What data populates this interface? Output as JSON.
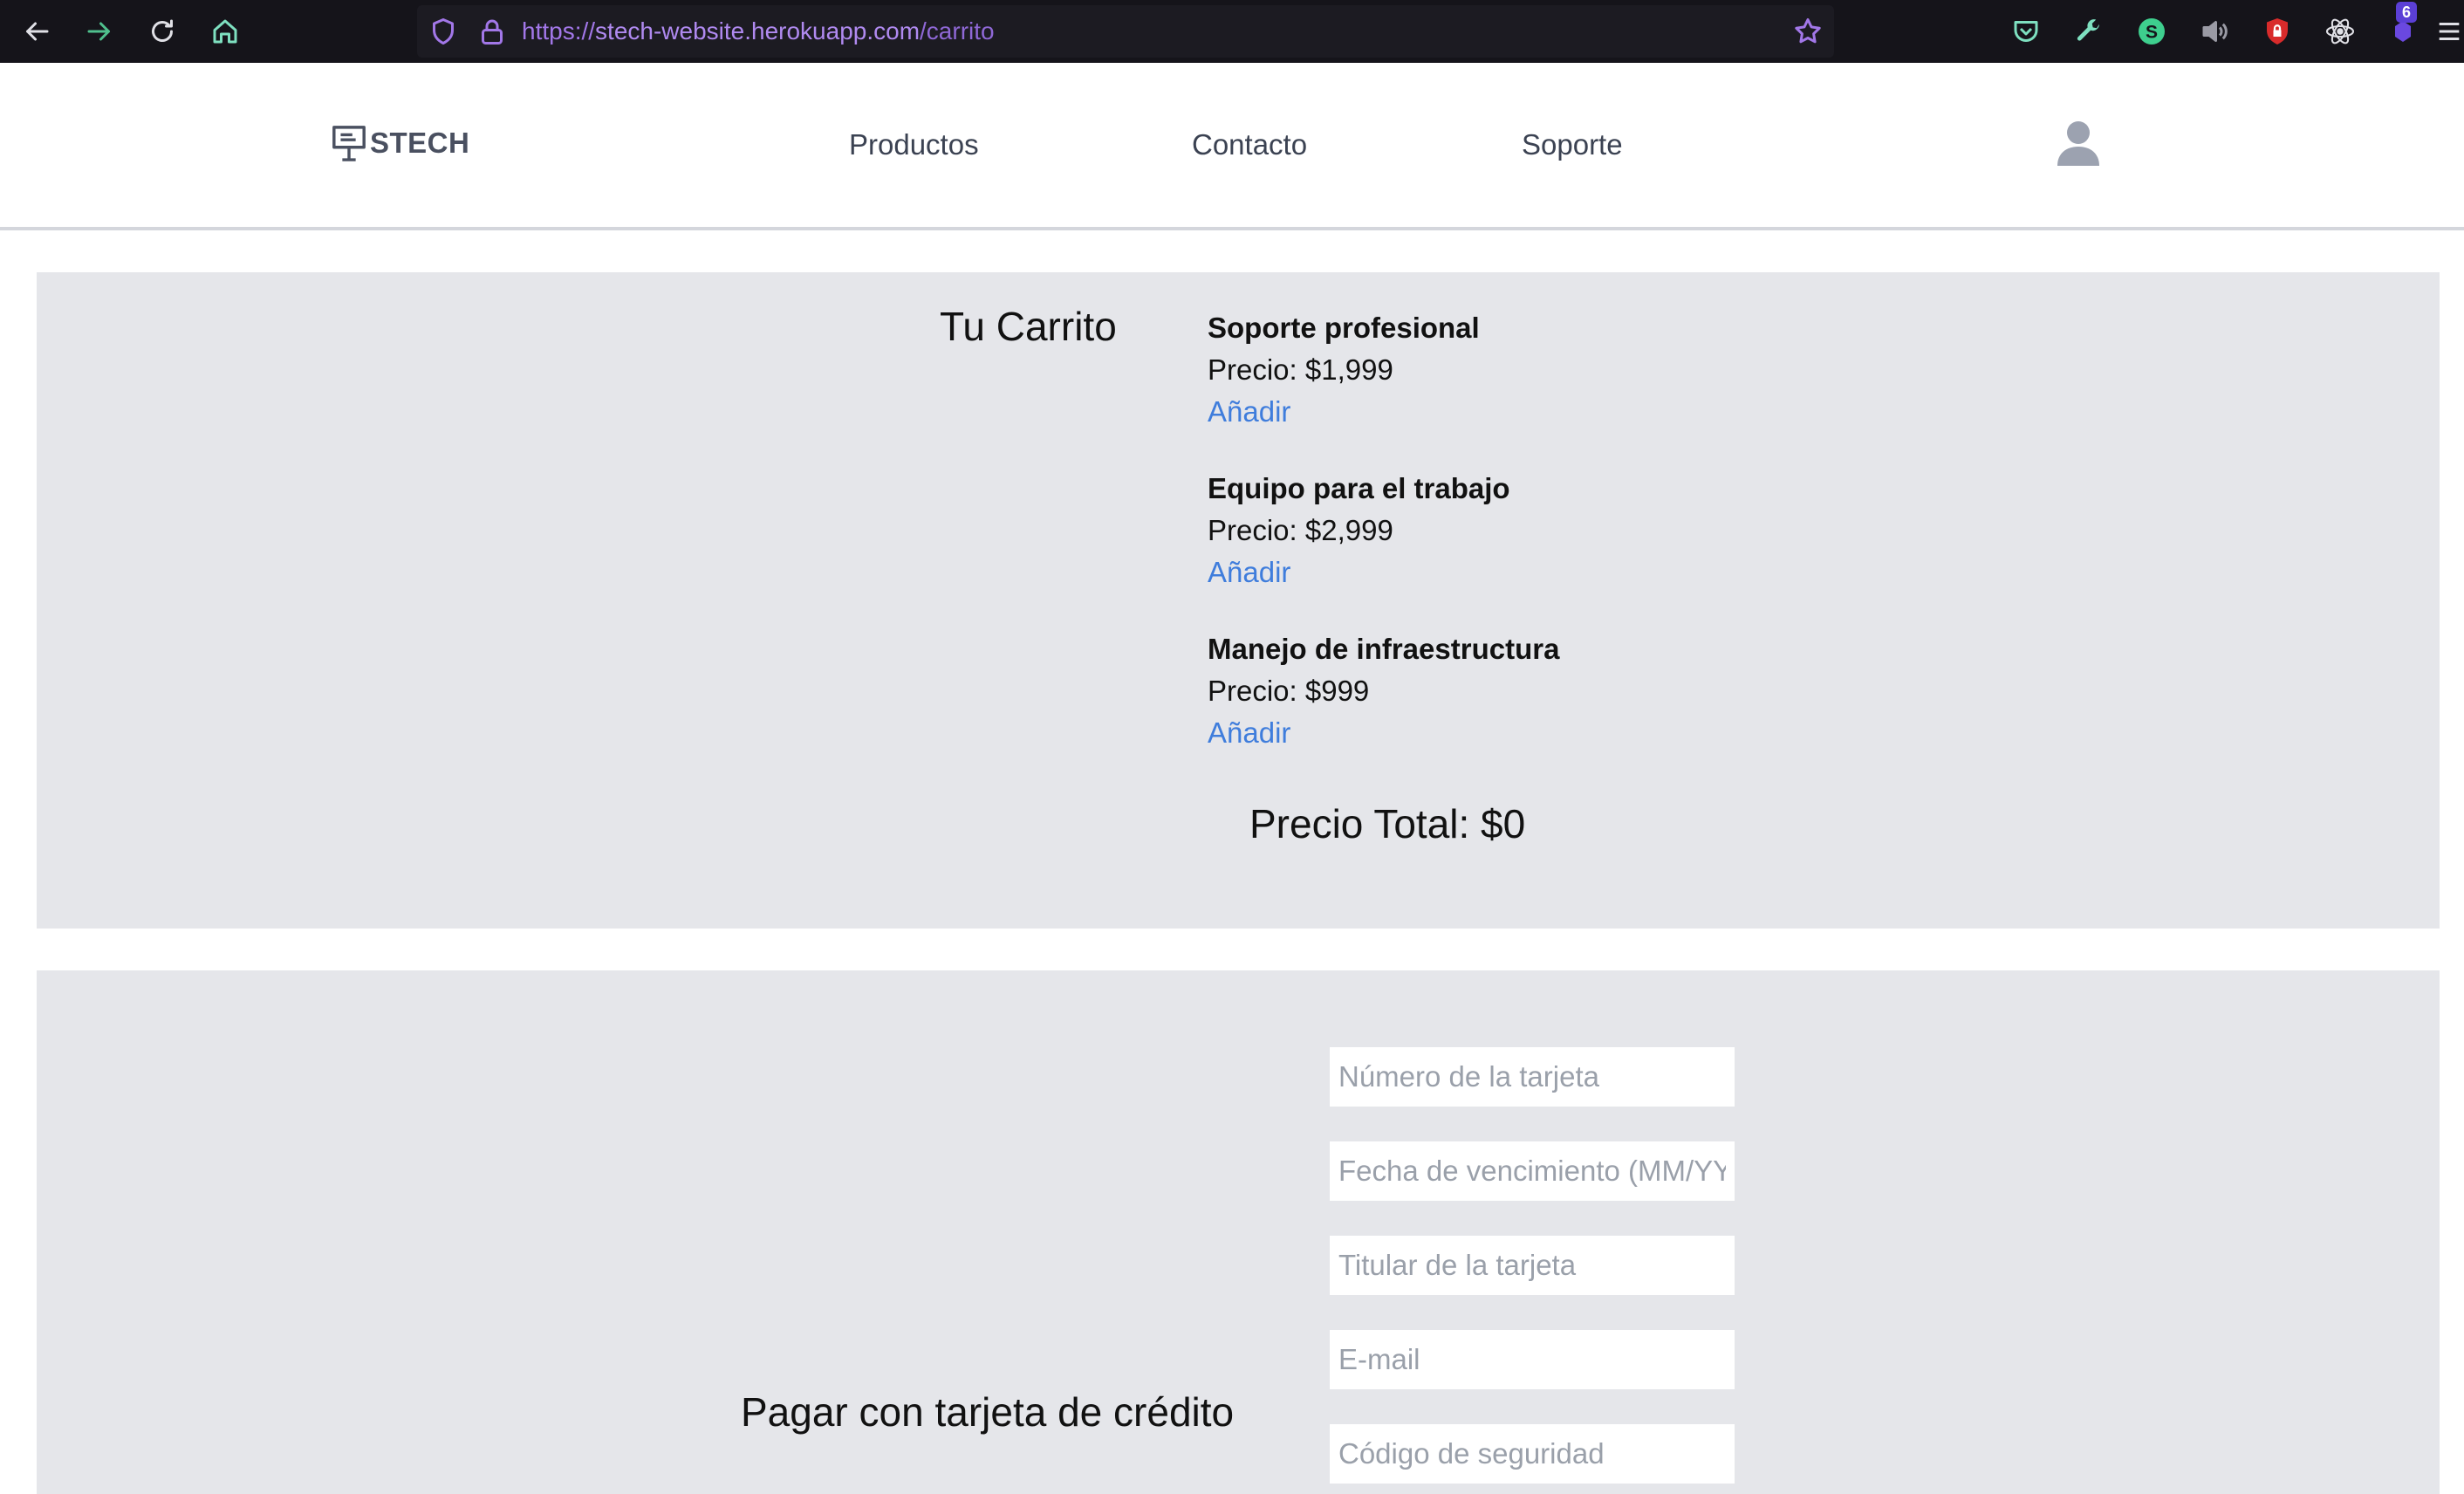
{
  "browser": {
    "url_scheme": "https://",
    "url_host": "stech-website.herokuapp.com",
    "url_path": "/carrito",
    "extension_badge": "6"
  },
  "header": {
    "logo_text": "STECH",
    "nav": [
      "Productos",
      "Contacto",
      "Soporte"
    ]
  },
  "cart": {
    "title": "Tu Carrito",
    "products": [
      {
        "name": "Soporte profesional",
        "price": "Precio: $1,999",
        "add_label": "Añadir"
      },
      {
        "name": "Equipo para el trabajo",
        "price": "Precio: $2,999",
        "add_label": "Añadir"
      },
      {
        "name": "Manejo de infraestructura",
        "price": "Precio: $999",
        "add_label": "Añadir"
      }
    ],
    "total": "Precio Total: $0"
  },
  "payment": {
    "title": "Pagar con tarjeta de crédito",
    "fields": [
      {
        "placeholder": "Número de la tarjeta",
        "value": ""
      },
      {
        "placeholder": "Fecha de vencimiento (MM/YY)",
        "value": ""
      },
      {
        "placeholder": "Titular de la tarjeta",
        "value": ""
      },
      {
        "placeholder": "E-mail",
        "value": ""
      },
      {
        "placeholder": "Código de seguridad",
        "value": ""
      }
    ]
  },
  "colors": {
    "chrome_bg": "#15141a",
    "panel_bg": "#e5e6ea",
    "link": "#3f7ddc",
    "url": "#a277e8"
  }
}
